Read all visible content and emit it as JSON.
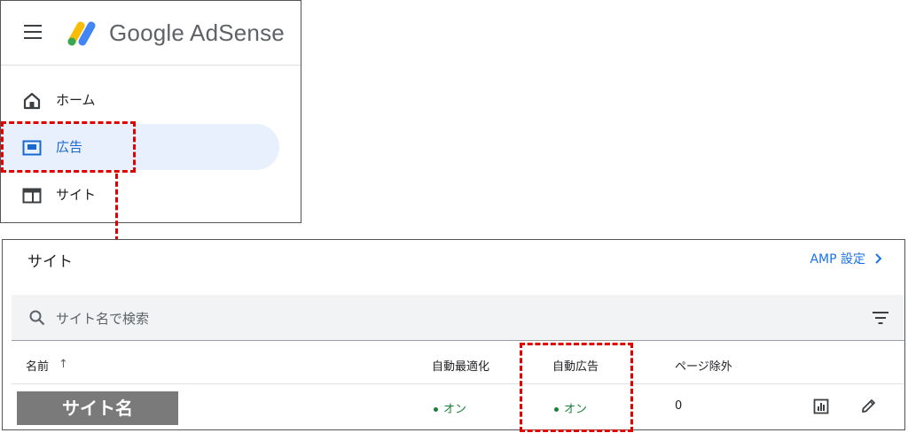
{
  "sidebar": {
    "brand": "Google AdSense",
    "menu_icon": "hamburger-menu-icon",
    "logo_icon": "adsense-logo-icon",
    "items": [
      {
        "label": "ホーム",
        "icon": "home-icon",
        "active": false
      },
      {
        "label": "広告",
        "icon": "ads-icon",
        "active": true
      },
      {
        "label": "サイト",
        "icon": "sites-icon",
        "active": false
      }
    ]
  },
  "sites": {
    "title": "サイト",
    "amp_link": "AMP 設定",
    "search": {
      "placeholder": "サイト名で検索",
      "icon": "search-icon"
    },
    "filter_icon": "filter-icon",
    "columns": {
      "name": "名前",
      "sort_indicator": "↑",
      "auto_optimize": "自動最適化",
      "auto_ads": "自動広告",
      "page_exclusions": "ページ除外"
    },
    "rows": [
      {
        "site_name": "サイト名",
        "auto_optimize": "オン",
        "auto_ads": "オン",
        "page_exclusions": "0"
      }
    ]
  },
  "colors": {
    "accent_blue": "#1a73e8",
    "active_bg": "#e8f0fe",
    "status_green": "#188038",
    "annotation_red": "#e00000",
    "masked_name_bg": "#7a7a7a"
  }
}
